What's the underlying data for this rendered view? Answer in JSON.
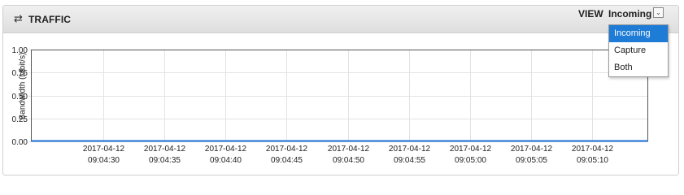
{
  "panel": {
    "title": "TRAFFIC",
    "icon": "swap-arrows-icon",
    "view_label": "VIEW",
    "view_selected": "Incoming"
  },
  "view_dropdown": {
    "options": [
      "Incoming",
      "Capture",
      "Both"
    ],
    "selected_index": 0,
    "highlight_color": "#1e7cd6"
  },
  "chart_data": {
    "type": "line",
    "ylabel": "Bandwidth (Mbit/s)",
    "ylim": [
      0,
      1.0
    ],
    "yticks": [
      "1.00",
      "0.75",
      "0.50",
      "0.25",
      "0.00"
    ],
    "x_dates": [
      "2017-04-12",
      "2017-04-12",
      "2017-04-12",
      "2017-04-12",
      "2017-04-12",
      "2017-04-12",
      "2017-04-12",
      "2017-04-12",
      "2017-04-12"
    ],
    "x_times": [
      "09:04:30",
      "09:04:35",
      "09:04:40",
      "09:04:45",
      "09:04:50",
      "09:04:55",
      "09:05:00",
      "09:05:05",
      "09:05:10"
    ],
    "series": [
      {
        "values": [
          0,
          0,
          0,
          0,
          0,
          0,
          0,
          0,
          0
        ],
        "color": "#1e6fd6"
      }
    ],
    "grid": true
  }
}
